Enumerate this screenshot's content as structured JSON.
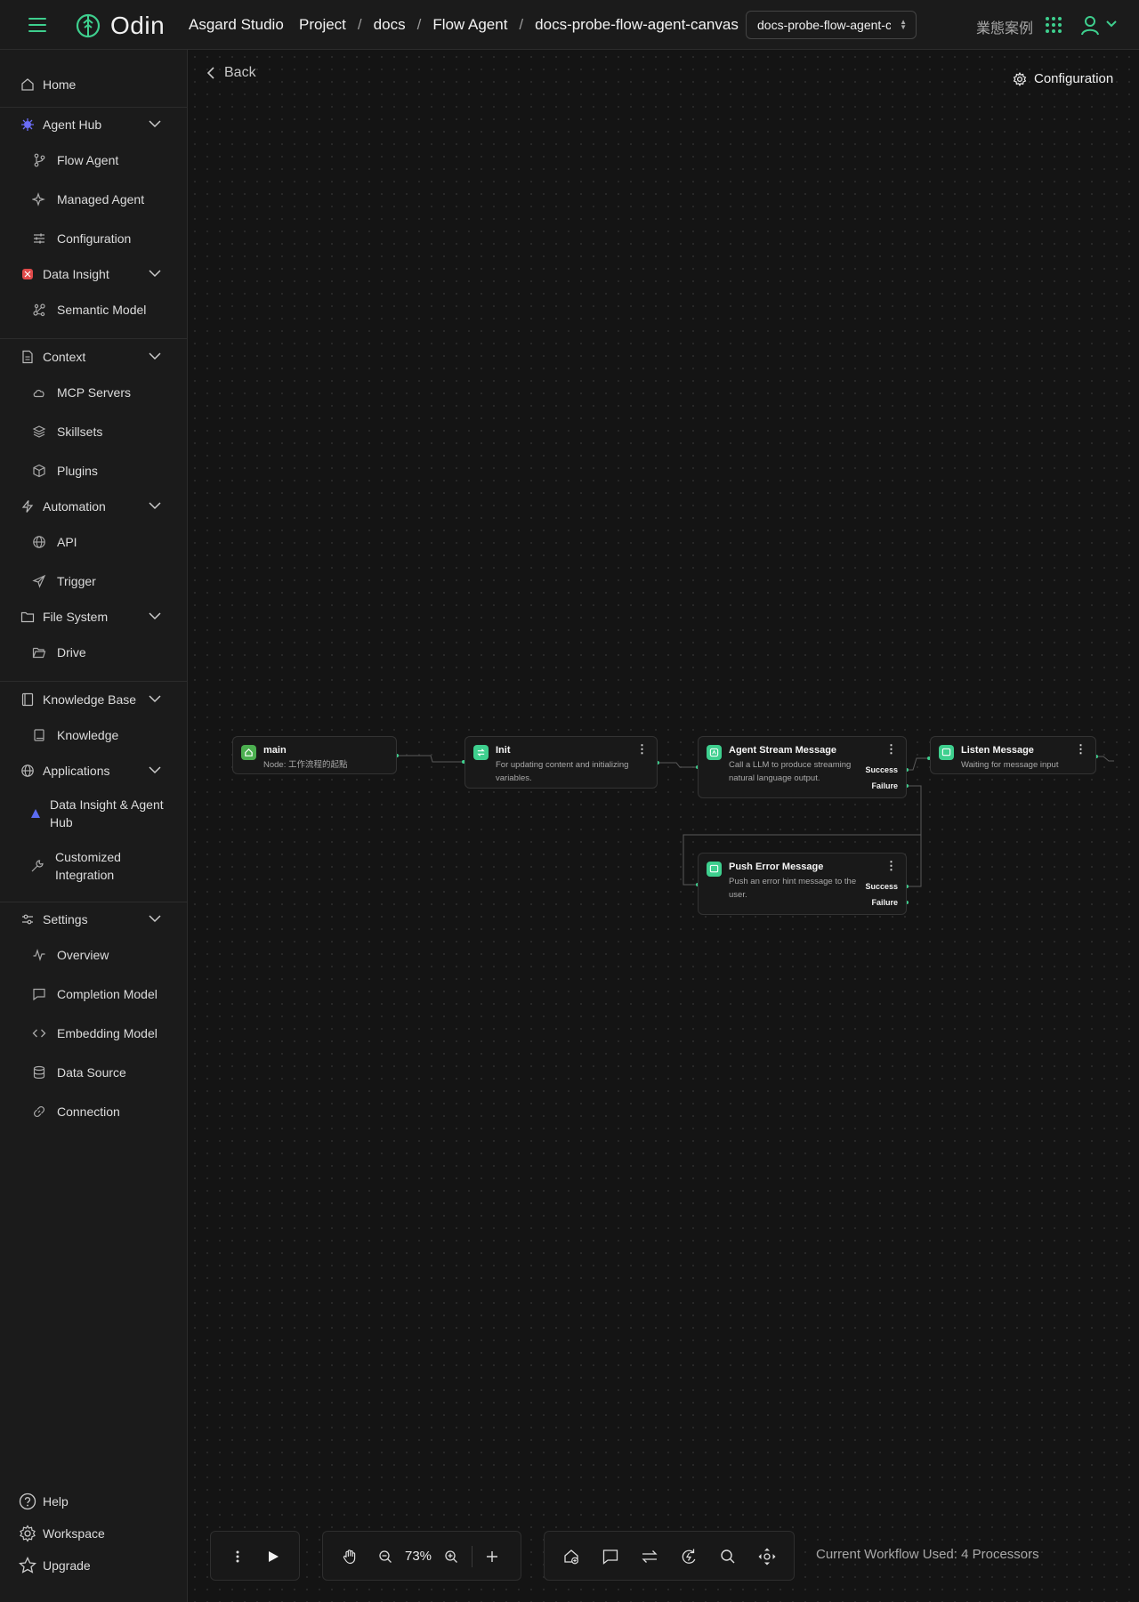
{
  "header": {
    "logo_text": "Odin",
    "studio": "Asgard Studio",
    "breadcrumbs": [
      "Project",
      "docs",
      "Flow Agent",
      "docs-probe-flow-agent-canvas"
    ],
    "agent_select_value": "docs-probe-flow-agent-canvas",
    "cases_label": "業態案例",
    "accent_color": "#3ecf8e"
  },
  "sidebar": {
    "home": "Home",
    "agent_hub": "Agent Hub",
    "flow_agent": "Flow Agent",
    "managed_agent": "Managed Agent",
    "configuration": "Configuration",
    "data_insight": "Data Insight",
    "semantic_model": "Semantic Model",
    "context": "Context",
    "mcp_servers": "MCP Servers",
    "skillsets": "Skillsets",
    "plugins": "Plugins",
    "automation": "Automation",
    "api": "API",
    "trigger": "Trigger",
    "file_system": "File System",
    "drive": "Drive",
    "knowledge_base": "Knowledge Base",
    "knowledge": "Knowledge",
    "applications": "Applications",
    "data_insight_agent_hub": "Data Insight & Agent Hub",
    "customized_integration": "Customized Integration",
    "settings": "Settings",
    "overview": "Overview",
    "completion_model": "Completion Model",
    "embedding_model": "Embedding Model",
    "data_source": "Data Source",
    "connection": "Connection",
    "help": "Help",
    "workspace": "Workspace",
    "upgrade": "Upgrade"
  },
  "canvas": {
    "back": "Back",
    "configuration": "Configuration",
    "nodes": {
      "main": {
        "title": "main",
        "desc": "Node: 工作流程的起點"
      },
      "init": {
        "title": "Init",
        "desc": "For updating content and initializing variables."
      },
      "agent_stream": {
        "title": "Agent Stream Message",
        "desc": "Call a LLM to produce streaming natural language output.",
        "success": "Success",
        "failure": "Failure"
      },
      "listen": {
        "title": "Listen Message",
        "desc": "Waiting for message input"
      },
      "push_error": {
        "title": "Push Error Message",
        "desc": "Push an error hint message to the user.",
        "success": "Success",
        "failure": "Failure"
      }
    }
  },
  "toolbar": {
    "zoom": "73%",
    "workflow_status": "Current Workflow Used: 4 Processors"
  }
}
